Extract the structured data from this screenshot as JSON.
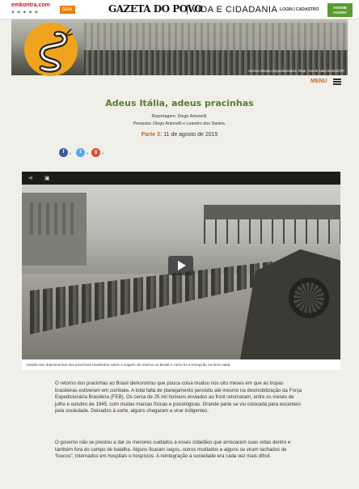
{
  "topbar": {
    "brand": "emkontra.com",
    "guia": "GUIA",
    "gazeta": "GAZETA DO POVO",
    "section": "| VIDA E CIDADANIA",
    "login": "LOGIN | CADASTRO",
    "subscribe": "ASSINE AGORA"
  },
  "hero": {
    "credit": "Acervo Museu Expedicionário. Repr. Aniele Nascimento/GP"
  },
  "menu": {
    "label": "MENU"
  },
  "article": {
    "title": "Adeus Itália, adeus pracinhas",
    "reportagem": "Reportagem: Diego Antonelli.",
    "pesquisa": "Pesquisa: Diego Antonelli e Leandro dos Santos.",
    "part_label": "Parte 3:",
    "part_date": " 11 de agosto de 2015"
  },
  "share": {
    "facebook_count": "0",
    "twitter_count": "0",
    "google_count": "0"
  },
  "video": {
    "caption": "Assista aos depoimentos dos pracinhas brasileiros sobre a viagem de retorno ao Brasil e como foi a recepção na terra natal."
  },
  "body": {
    "p1": "O retorno dos pracinhas ao Brasil demonstrou que pouca coisa mudou nos oito meses em que as tropas brasileiras estiveram em combate. A total falta de planejamento persistiu até mesmo na desmobilização da Força Expedicionária Brasileira (FEB). Os cerca de 25 mil homens enviados ao front retornaram, entre os meses de julho e outubro de 1945, com muitas marcas físicas e psicológicas. Grande parte se viu colocada para escanteio pela sociedade. Deixados à sorte, alguns chegaram a virar indigentes.",
    "p2": "O governo não se prestou a dar os menores cuidados a esses cidadãos que arriscaram suas vidas dentro e também fora do campo de batalha. Alguns ficaram cegos, outros mutilados e alguns se viram tachados de “loucos”, internados em hospitais e hospícios. A reintegração à sociedade era cada vez mais difícil."
  },
  "colors": {
    "accent_green": "#5a7d2a",
    "accent_orange": "#c4692b",
    "logo_orange": "#f0a31c"
  }
}
